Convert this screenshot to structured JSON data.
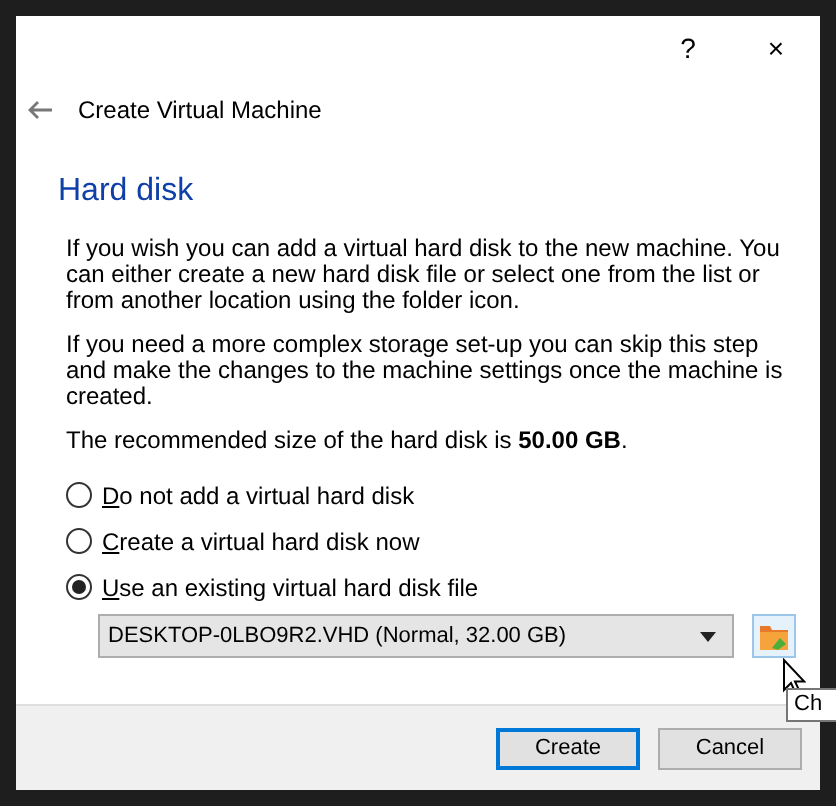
{
  "window": {
    "help": "?",
    "close": "×"
  },
  "header": {
    "title": "Create Virtual Machine"
  },
  "page": {
    "heading": "Hard disk",
    "paragraphs": [
      "If you wish you can add a virtual hard disk to the new machine. You can either create a new hard disk file or select one from the list or from another location using the folder icon.",
      "If you need a more complex storage set-up you can skip this step and make the changes to the machine settings once the machine is created.",
      "The recommended size of the hard disk is **50.00 GB**."
    ],
    "options": [
      {
        "label": "Do not add a virtual hard disk",
        "underline_first": true,
        "selected": false
      },
      {
        "label": "Create a virtual hard disk now",
        "underline_first": true,
        "selected": false
      },
      {
        "label": "Use an existing virtual hard disk file",
        "underline_first": true,
        "selected": true
      }
    ],
    "disk_select": {
      "value": "DESKTOP-0LBO9R2.VHD (Normal, 32.00 GB)"
    },
    "tooltip": "Ch"
  },
  "buttons": [
    {
      "label": "Create",
      "default": true
    },
    {
      "label": "Cancel",
      "default": false
    }
  ]
}
